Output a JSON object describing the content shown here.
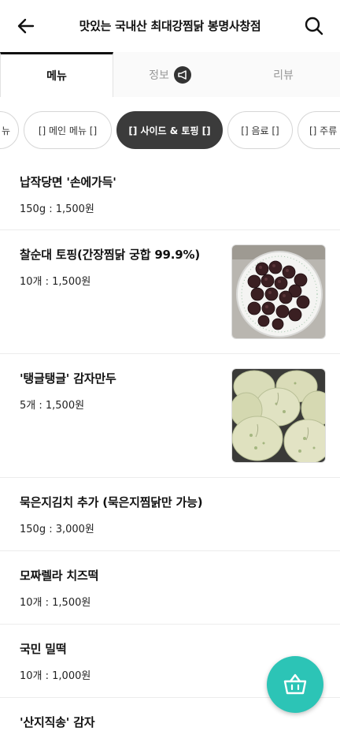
{
  "header": {
    "title": "맛있는 국내산 최대강찜닭 봉명사창점",
    "back_icon": "arrow-left-icon",
    "search_icon": "search-icon"
  },
  "tabs": [
    {
      "label": "메뉴",
      "active": true
    },
    {
      "label": "정보",
      "active": false,
      "icon": "megaphone-icon"
    },
    {
      "label": "리뷰",
      "active": false
    }
  ],
  "categories": [
    {
      "label": "뉴",
      "active": false
    },
    {
      "label": "[] 메인 메뉴 []",
      "active": false
    },
    {
      "label": "[] 사이드 & 토핑 []",
      "active": true
    },
    {
      "label": "[] 음료 []",
      "active": false
    },
    {
      "label": "[] 주류",
      "active": false
    }
  ],
  "menu_items": [
    {
      "name": "납작당면 '손에가득'",
      "price": "150g : 1,500원",
      "has_image": false
    },
    {
      "name": "찰순대 토핑(간장찜닭 궁합 99.9%)",
      "price": "10개 : 1,500원",
      "has_image": true,
      "image": "sundae-photo"
    },
    {
      "name": "'탱글탱글' 감자만두",
      "price": "5개 : 1,500원",
      "has_image": true,
      "image": "dumpling-photo"
    },
    {
      "name": "묵은지김치 추가 (묵은지찜닭만 가능)",
      "price": "150g : 3,000원",
      "has_image": false
    },
    {
      "name": "모짜렐라 치즈떡",
      "price": "10개 : 1,500원",
      "has_image": false
    },
    {
      "name": "국민 밀떡",
      "price": "10개 : 1,000원",
      "has_image": false
    },
    {
      "name": "'산지직송' 감자",
      "price": "",
      "has_image": false
    }
  ],
  "cart_button": {
    "icon": "basket-icon"
  },
  "colors": {
    "accent": "#2cc4b6",
    "active_chip": "#3b3b3b",
    "divider": "#ececec"
  }
}
